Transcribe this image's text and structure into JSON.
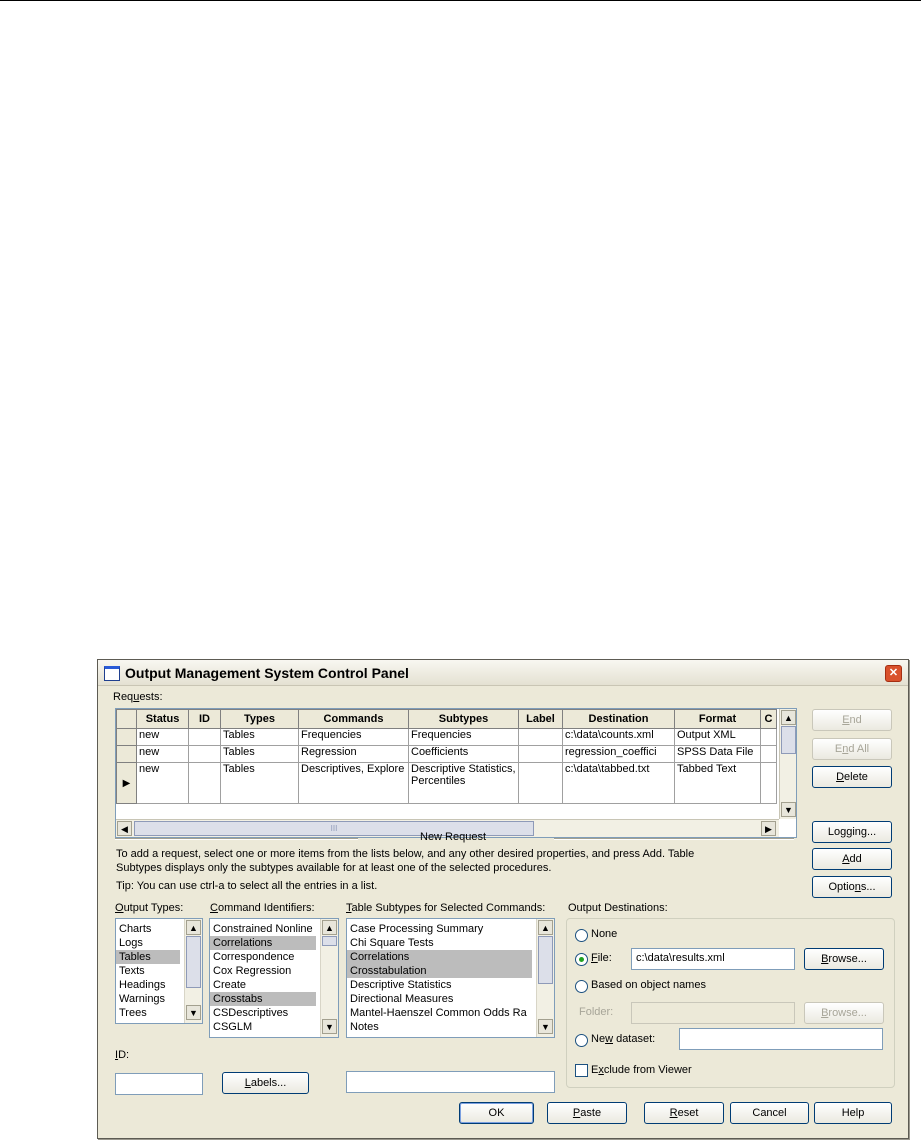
{
  "dialog": {
    "title": "Output Management System Control Panel",
    "close_glyph": "✕"
  },
  "requests": {
    "label_pre": "Req",
    "label_ul": "u",
    "label_post": "ests:",
    "columns": [
      "Status",
      "ID",
      "Types",
      "Commands",
      "Subtypes",
      "Label",
      "Destination",
      "Format",
      "C"
    ],
    "rows": [
      {
        "status": "new",
        "id": "",
        "types": "Tables",
        "commands": "Frequencies",
        "subtypes": "Frequencies",
        "label": "",
        "destination": "c:\\data\\counts.xml",
        "format": "Output XML"
      },
      {
        "status": "new",
        "id": "",
        "types": "Tables",
        "commands": "Regression",
        "subtypes": "Coefficients",
        "label": "",
        "destination": "regression_coeffici",
        "format": "SPSS Data File"
      },
      {
        "status": "new",
        "id": "",
        "types": "Tables",
        "commands": "Descriptives, Explore",
        "subtypes": "Descriptive Statistics, Percentiles",
        "label": "",
        "destination": "c:\\data\\tabbed.txt",
        "format": "Tabbed Text"
      }
    ],
    "current_row_glyph": "▶",
    "hscroll_grip": "III"
  },
  "side_buttons": {
    "end": {
      "label_ul": "E",
      "label_post": "nd"
    },
    "end_all": {
      "label_pre": "E",
      "label_ul": "n",
      "label_post": "d All"
    },
    "delete": {
      "label_ul": "D",
      "label_post": "elete"
    },
    "logging": {
      "label_pre": "Lo",
      "label_ul": "g",
      "label_post": "ging..."
    },
    "add": {
      "label_ul": "A",
      "label_post": "dd"
    },
    "options": {
      "label_pre": "Optio",
      "label_ul": "n",
      "label_post": "s..."
    }
  },
  "new_request": {
    "heading": "New Request",
    "instructions_1": "To add a request, select one or more items from the lists below, and any other desired properties, and press Add. Table",
    "instructions_2": "Subtypes displays only the subtypes available for at least one of the selected procedures.",
    "tip": "Tip: You can use ctrl-a to select all the entries in a list."
  },
  "output_types": {
    "label_ul": "O",
    "label_post": "utput Types:",
    "items": [
      {
        "text": "Charts",
        "selected": false
      },
      {
        "text": "Logs",
        "selected": false
      },
      {
        "text": "Tables",
        "selected": true
      },
      {
        "text": "Texts",
        "selected": false
      },
      {
        "text": "Headings",
        "selected": false
      },
      {
        "text": "Warnings",
        "selected": false
      },
      {
        "text": "Trees",
        "selected": false
      }
    ]
  },
  "command_identifiers": {
    "label_ul": "C",
    "label_post": "ommand Identifiers:",
    "items": [
      {
        "text": "Constrained Nonline",
        "selected": false
      },
      {
        "text": "Correlations",
        "selected": true
      },
      {
        "text": "Correspondence",
        "selected": false
      },
      {
        "text": "Cox Regression",
        "selected": false
      },
      {
        "text": "Create",
        "selected": false
      },
      {
        "text": "Crosstabs",
        "selected": true
      },
      {
        "text": "CSDescriptives",
        "selected": false
      },
      {
        "text": "CSGLM",
        "selected": false
      }
    ]
  },
  "table_subtypes": {
    "label_ul": "T",
    "label_post": "able Subtypes for Selected Commands:",
    "items": [
      {
        "text": "Case Processing Summary",
        "selected": false
      },
      {
        "text": "Chi Square Tests",
        "selected": false
      },
      {
        "text": "Correlations",
        "selected": true
      },
      {
        "text": "Crosstabulation",
        "selected": true
      },
      {
        "text": "Descriptive Statistics",
        "selected": false
      },
      {
        "text": "Directional Measures",
        "selected": false
      },
      {
        "text": "Mantel-Haenszel Common Odds Ra",
        "selected": false
      },
      {
        "text": "Notes",
        "selected": false
      }
    ]
  },
  "id_field": {
    "label_ul": "I",
    "label_post": "D:",
    "value": ""
  },
  "labels_button": {
    "label_ul": "L",
    "label_post": "abels..."
  },
  "label_field": {
    "value": ""
  },
  "output_destinations": {
    "label": "Output Destinations:",
    "none": {
      "label": "None",
      "selected": false
    },
    "file": {
      "label_ul": "F",
      "label_post": "ile:",
      "selected": true,
      "value": "c:\\data\\results.xml",
      "browse_ul": "B",
      "browse_post": "rowse..."
    },
    "based_on_names": {
      "label": "Based on object names",
      "selected": false,
      "folder_label": "Folder:",
      "folder_value": "",
      "browse_ul": "B",
      "browse_post": "rowse..."
    },
    "new_dataset": {
      "label_pre": "Ne",
      "label_ul": "w",
      "label_post": " dataset:",
      "selected": false,
      "value": ""
    },
    "exclude": {
      "label_pre": "E",
      "label_ul": "x",
      "label_post": "clude from Viewer",
      "checked": false
    }
  },
  "footer": {
    "ok": "OK",
    "paste": {
      "label_ul": "P",
      "label_post": "aste"
    },
    "reset": {
      "label_ul": "R",
      "label_post": "eset"
    },
    "cancel": "Cancel",
    "help": "Help"
  }
}
